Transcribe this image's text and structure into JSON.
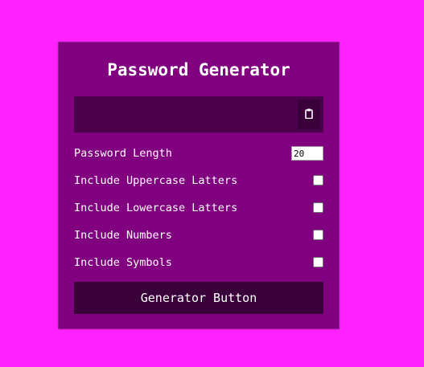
{
  "app": {
    "title": "Password Generator"
  },
  "result": {
    "value": "",
    "copy_icon": "clipboard-icon"
  },
  "settings": {
    "length_label": "Password Length",
    "length_value": "20",
    "options": [
      {
        "label": "Include Uppercase Latters",
        "checked": false
      },
      {
        "label": "Include Lowercase Latters",
        "checked": false
      },
      {
        "label": "Include Numbers",
        "checked": false
      },
      {
        "label": "Include Symbols",
        "checked": false
      }
    ]
  },
  "generate": {
    "label": "Generator Button"
  },
  "colors": {
    "page_background": "#ff22ff",
    "card_background": "#800080",
    "result_background": "#4a004a",
    "button_background": "#3a003a",
    "text": "#ffffff"
  }
}
